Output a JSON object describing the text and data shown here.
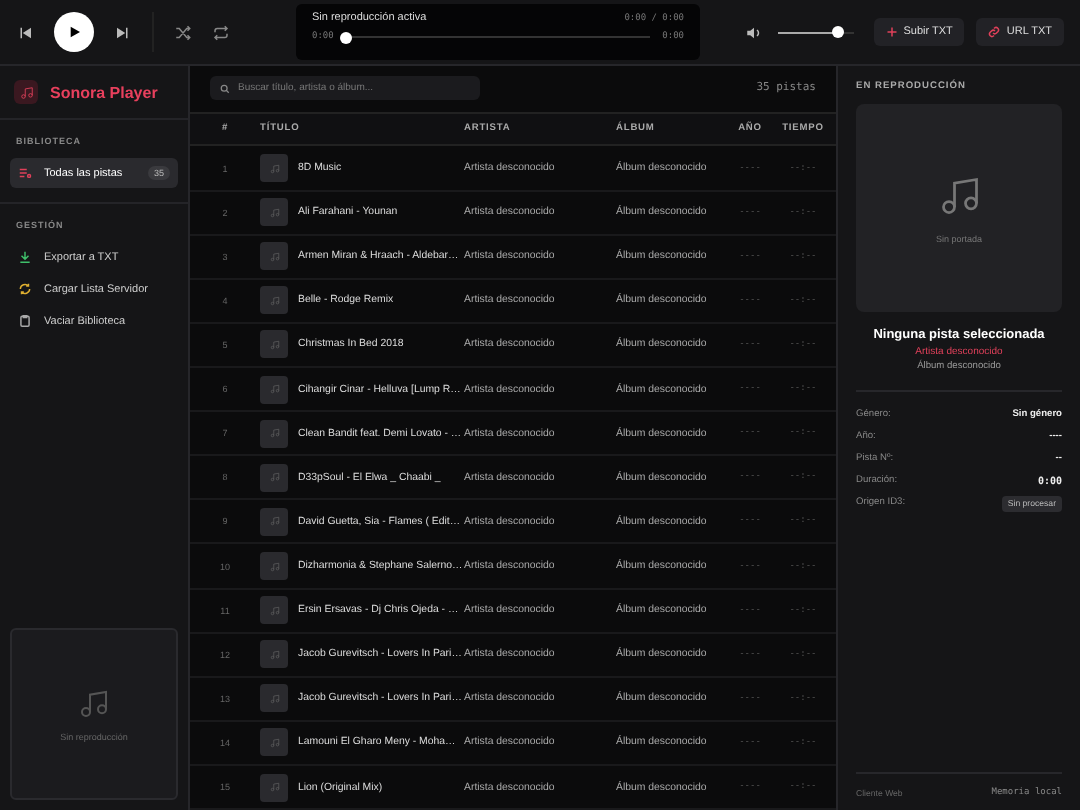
{
  "player": {
    "status": "Sin reproducción activa",
    "time_total": "0:00 / 0:00",
    "elapsed": "0:00",
    "duration": "0:00",
    "level": 0,
    "volume": {
      "level": 0.8
    },
    "buttons": [
      {
        "kind": "upload",
        "label": "Subir TXT"
      },
      {
        "kind": "link",
        "label": "URL TXT"
      }
    ]
  },
  "sidebar": {
    "app_name": "Sonora Player",
    "sections": [
      {
        "title": "BIBLIOTECA",
        "items": [
          {
            "kind": "library",
            "label": "Todas las pistas",
            "count": "35",
            "selected": true
          }
        ]
      },
      {
        "title": "GESTIÓN",
        "items": [
          {
            "kind": "export",
            "label": "Exportar a TXT",
            "selected": false
          },
          {
            "kind": "load",
            "label": "Cargar Lista Servidor",
            "selected": false
          },
          {
            "kind": "clear",
            "label": "Vaciar Biblioteca",
            "selected": false
          }
        ]
      }
    ],
    "mini_player": {
      "label": "Sin reproducción"
    }
  },
  "search": {
    "placeholder": "Buscar título, artista o álbum..."
  },
  "track_count": "35 pistas",
  "table": {
    "columns": [
      "#",
      "TÍTULO",
      "ARTISTA",
      "ÁLBUM",
      "AÑO",
      "TIEMPO"
    ],
    "rows": [
      {
        "n": "1",
        "title": "8D Music",
        "artist": "Artista desconocido",
        "album": "Álbum desconocido",
        "year": "----",
        "time": "--:--"
      },
      {
        "n": "2",
        "title": "Ali Farahani - Younan",
        "artist": "Artista desconocido",
        "album": "Álbum desconocido",
        "year": "----",
        "time": "--:--"
      },
      {
        "n": "3",
        "title": "Armen Miran & Hraach - Aldebar…",
        "artist": "Artista desconocido",
        "album": "Álbum desconocido",
        "year": "----",
        "time": "--:--"
      },
      {
        "n": "4",
        "title": "Belle - Rodge Remix",
        "artist": "Artista desconocido",
        "album": "Álbum desconocido",
        "year": "----",
        "time": "--:--"
      },
      {
        "n": "5",
        "title": "Christmas In Bed 2018",
        "artist": "Artista desconocido",
        "album": "Álbum desconocido",
        "year": "----",
        "time": "--:--"
      },
      {
        "n": "6",
        "title": "Cihangir Cinar - Helluva [Lump R…",
        "artist": "Artista desconocido",
        "album": "Álbum desconocido",
        "year": "----",
        "time": "--:--"
      },
      {
        "n": "7",
        "title": "Clean Bandit feat. Demi Lovato - …",
        "artist": "Artista desconocido",
        "album": "Álbum desconocido",
        "year": "----",
        "time": "--:--"
      },
      {
        "n": "8",
        "title": "D33pSoul - El Elwa _ Chaabi _",
        "artist": "Artista desconocido",
        "album": "Álbum desconocido",
        "year": "----",
        "time": "--:--"
      },
      {
        "n": "9",
        "title": "David Guetta, Sia - Flames ( Edit…",
        "artist": "Artista desconocido",
        "album": "Álbum desconocido",
        "year": "----",
        "time": "--:--"
      },
      {
        "n": "10",
        "title": "Dizharmonia & Stephane Salerno…",
        "artist": "Artista desconocido",
        "album": "Álbum desconocido",
        "year": "----",
        "time": "--:--"
      },
      {
        "n": "11",
        "title": "Ersin Ersavas - Dj Chris Ojeda - …",
        "artist": "Artista desconocido",
        "album": "Álbum desconocido",
        "year": "----",
        "time": "--:--"
      },
      {
        "n": "12",
        "title": "Jacob Gurevitsch - Lovers In Pari…",
        "artist": "Artista desconocido",
        "album": "Álbum desconocido",
        "year": "----",
        "time": "--:--"
      },
      {
        "n": "13",
        "title": "Jacob Gurevitsch - Lovers In Pari…",
        "artist": "Artista desconocido",
        "album": "Álbum desconocido",
        "year": "----",
        "time": "--:--"
      },
      {
        "n": "14",
        "title": "Lamouni El Gharo Meny - Moha…",
        "artist": "Artista desconocido",
        "album": "Álbum desconocido",
        "year": "----",
        "time": "--:--"
      },
      {
        "n": "15",
        "title": "Lion (Original Mix)",
        "artist": "Artista desconocido",
        "album": "Álbum desconocido",
        "year": "----",
        "time": "--:--"
      }
    ]
  },
  "now_playing": {
    "heading": "EN REPRODUCCIÓN",
    "cover_label": "Sin portada",
    "title": "Ninguna pista seleccionada",
    "artist": "Artista desconocido",
    "album": "Álbum desconocido",
    "details": [
      {
        "kind": "text",
        "label": "Género:",
        "value": "Sin género"
      },
      {
        "kind": "text",
        "label": "Año:",
        "value": "----"
      },
      {
        "kind": "text",
        "label": "Pista Nº:",
        "value": "--"
      },
      {
        "kind": "mono",
        "label": "Duración:",
        "value": "0:00"
      },
      {
        "kind": "badge",
        "label": "Origen ID3:",
        "value": "Sin procesar"
      }
    ],
    "footer_left": "Cliente Web",
    "footer_right": "Memoria local"
  }
}
